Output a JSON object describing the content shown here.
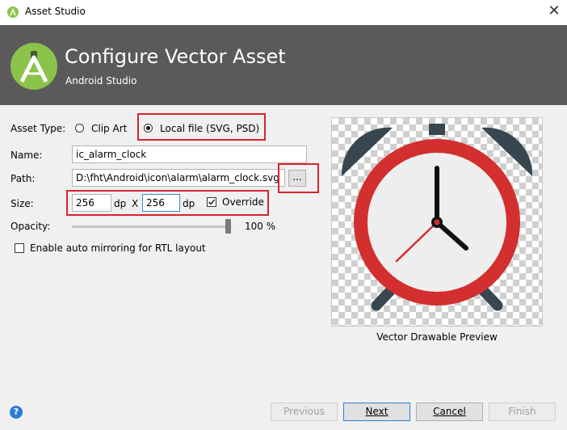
{
  "window": {
    "title": "Asset Studio",
    "close_glyph": "✕"
  },
  "header": {
    "title": "Configure Vector Asset",
    "subtitle": "Android Studio"
  },
  "form": {
    "asset_type_label": "Asset Type:",
    "options": [
      {
        "label": "Clip Art",
        "selected": false
      },
      {
        "label": "Local file (SVG, PSD)",
        "selected": true
      }
    ],
    "name_label": "Name:",
    "name_value": "ic_alarm_clock",
    "path_label": "Path:",
    "path_value": "D:\\fht\\Android\\icon\\alarm\\alarm_clock.svg",
    "browse_label": "...",
    "size_label": "Size:",
    "width_value": "256",
    "height_value": "256",
    "unit": "dp",
    "times": "X",
    "override_label": "Override",
    "override_checked": true,
    "opacity_label": "Opacity:",
    "opacity_value": "100 %",
    "opacity_fraction": 1.0,
    "rtl_label": "Enable auto mirroring for RTL layout",
    "rtl_checked": false
  },
  "preview": {
    "caption": "Vector Drawable Preview"
  },
  "buttons": {
    "previous": "Previous",
    "next": "Next",
    "cancel": "Cancel",
    "finish": "Finish",
    "help": "?"
  },
  "colors": {
    "header_bg": "#5a5a5a",
    "android_green": "#8bc34a",
    "highlight_red": "#d9232e",
    "clock_red": "#d32f2f",
    "clock_dark": "#37474f",
    "accent_blue": "#2f7cd6"
  }
}
